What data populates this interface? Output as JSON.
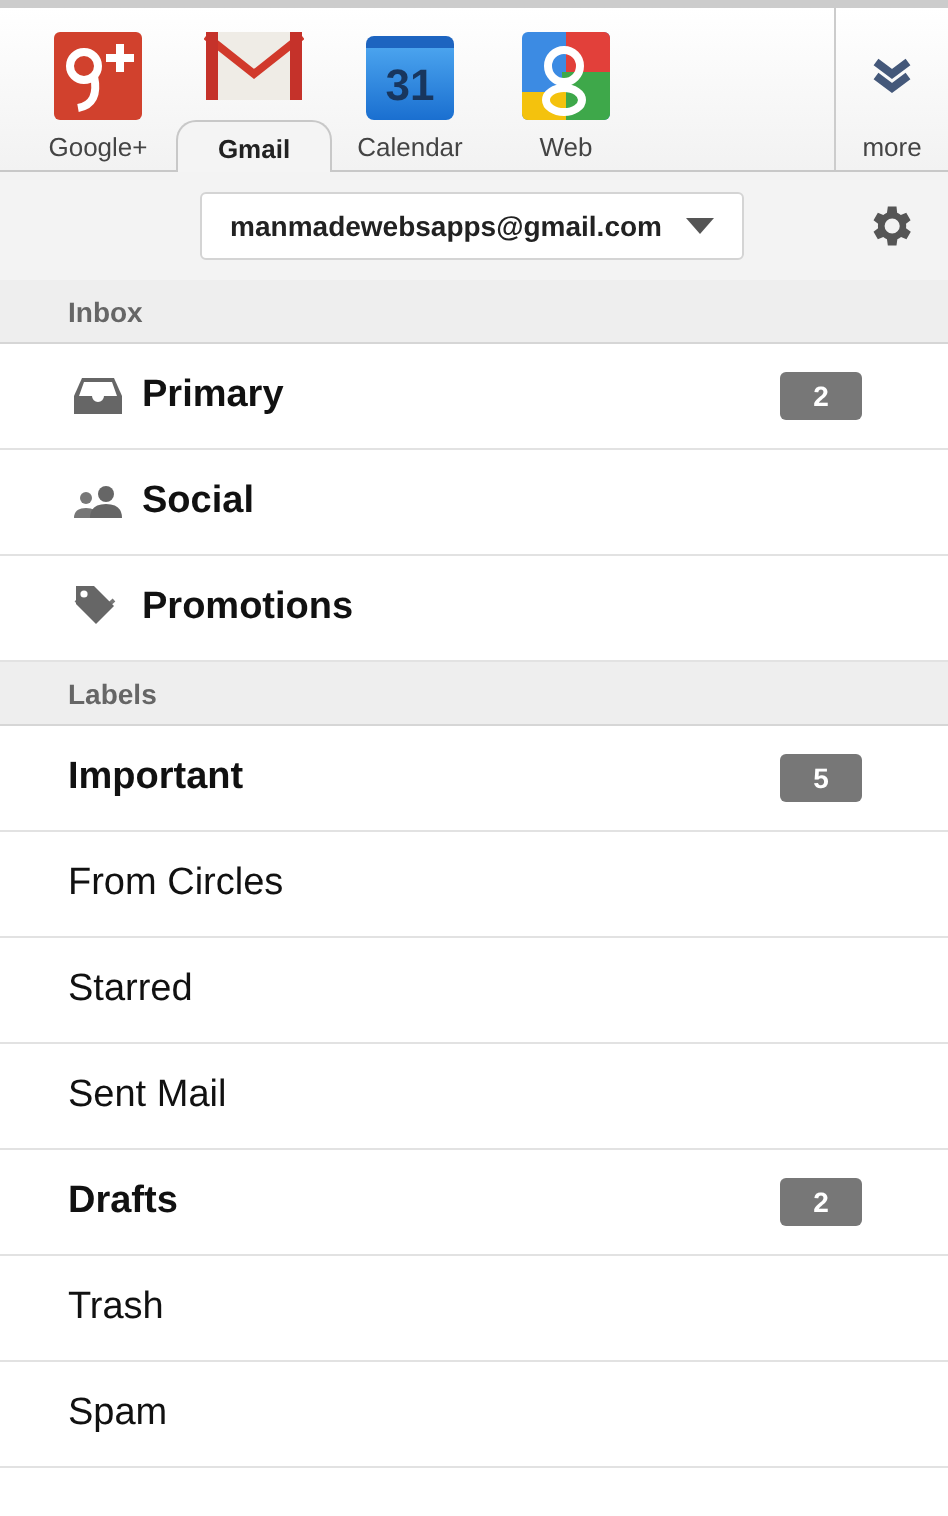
{
  "apps": [
    {
      "kind": "googleplus",
      "label": "Google+",
      "selected": false
    },
    {
      "kind": "gmail",
      "label": "Gmail",
      "selected": true
    },
    {
      "kind": "calendar",
      "label": "Calendar",
      "selected": false,
      "icon_text": "31"
    },
    {
      "kind": "web",
      "label": "Web",
      "selected": false
    }
  ],
  "more": {
    "label": "more"
  },
  "account": {
    "email": "manmadewebsapps@gmail.com"
  },
  "inbox": {
    "title": "Inbox",
    "items": [
      {
        "kind": "inbox",
        "label": "Primary",
        "count": "2"
      },
      {
        "kind": "social",
        "label": "Social"
      },
      {
        "kind": "promotions",
        "label": "Promotions"
      }
    ]
  },
  "labels": {
    "title": "Labels",
    "items": [
      {
        "label": "Important",
        "unread": true,
        "count": "5"
      },
      {
        "label": "From Circles",
        "unread": false
      },
      {
        "label": "Starred",
        "unread": false
      },
      {
        "label": "Sent Mail",
        "unread": false
      },
      {
        "label": "Drafts",
        "unread": true,
        "count": "2"
      },
      {
        "label": "Trash",
        "unread": false
      },
      {
        "label": "Spam",
        "unread": false
      }
    ]
  }
}
